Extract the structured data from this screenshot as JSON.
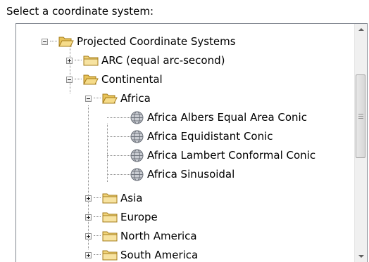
{
  "prompt_label": "Select a coordinate system:",
  "tree": {
    "projected": {
      "label": "Projected Coordinate Systems",
      "expanded": true
    },
    "arc": {
      "label": "ARC (equal arc-second)",
      "expanded": false
    },
    "continental": {
      "label": "Continental",
      "expanded": true
    },
    "africa": {
      "label": "Africa",
      "expanded": true
    },
    "africa_albers": {
      "label": "Africa Albers Equal Area Conic"
    },
    "africa_equidistant": {
      "label": "Africa Equidistant Conic"
    },
    "africa_lambert": {
      "label": "Africa Lambert Conformal Conic"
    },
    "africa_sinusoidal": {
      "label": "Africa Sinusoidal"
    },
    "asia": {
      "label": "Asia",
      "expanded": false
    },
    "europe": {
      "label": "Europe",
      "expanded": false
    },
    "north_america": {
      "label": "North America",
      "expanded": false
    },
    "south_america": {
      "label": "South America",
      "expanded": false
    }
  },
  "icons": {
    "folder": "folder-icon",
    "folder_open": "open-folder-icon",
    "globe": "globe-icon"
  },
  "colors": {
    "folder": "#f0d37a",
    "globe": "#8a8f98",
    "border": "#828790"
  }
}
